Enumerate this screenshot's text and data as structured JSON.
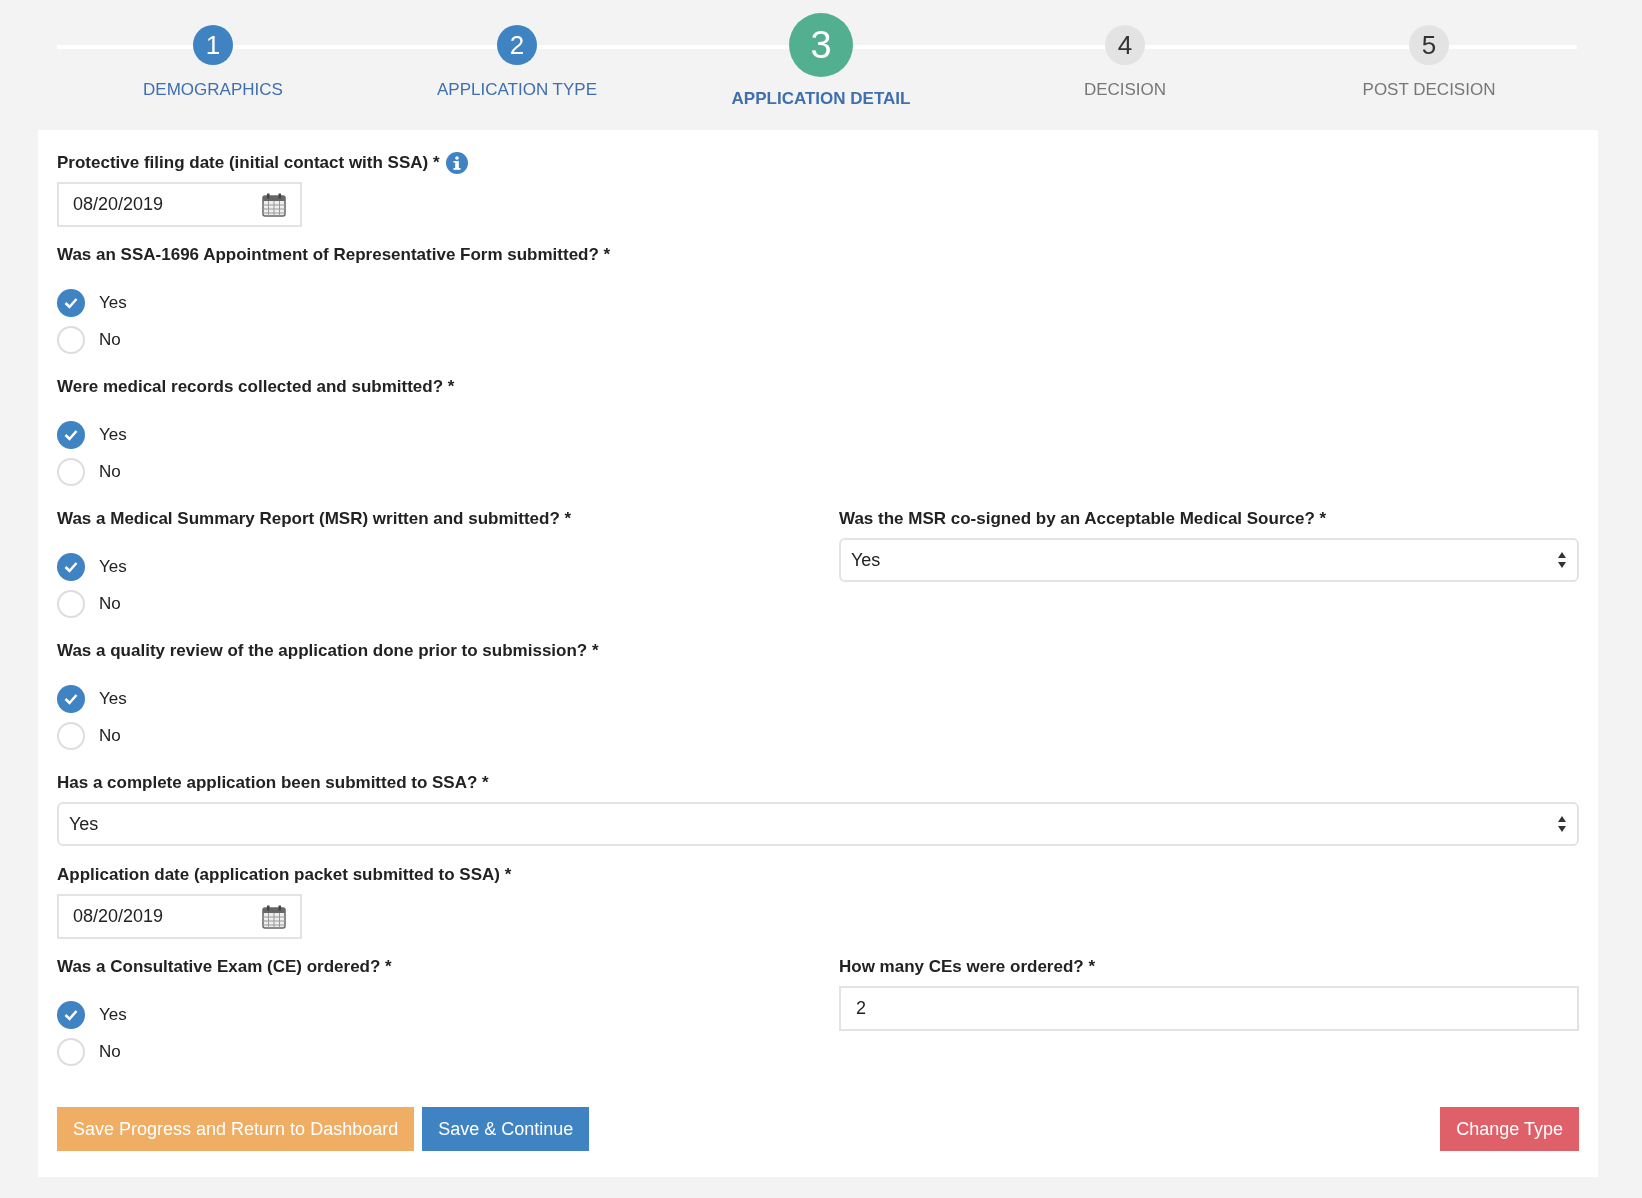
{
  "steps": [
    {
      "number": "1",
      "label": "DEMOGRAPHICS",
      "completed": true,
      "selected": false
    },
    {
      "number": "2",
      "label": "APPLICATION TYPE",
      "completed": true,
      "selected": false
    },
    {
      "number": "3",
      "label": "APPLICATION DETAIL",
      "completed": false,
      "selected": true
    },
    {
      "number": "4",
      "label": "DECISION",
      "completed": false,
      "selected": false
    },
    {
      "number": "5",
      "label": "POST DECISION",
      "completed": false,
      "selected": false
    }
  ],
  "rows": [
    {
      "fields": [
        {
          "kind": "date",
          "label": "Protective filing date (initial contact with SSA) *",
          "info": true,
          "value": "08/20/2019"
        }
      ]
    },
    {
      "fields": [
        {
          "kind": "radio",
          "label": "Was an SSA-1696 Appointment of Representative Form submitted? *",
          "options": [
            {
              "label": "Yes",
              "selected": true
            },
            {
              "label": "No",
              "selected": false
            }
          ]
        }
      ]
    },
    {
      "fields": [
        {
          "kind": "radio",
          "label": "Were medical records collected and submitted? *",
          "options": [
            {
              "label": "Yes",
              "selected": true
            },
            {
              "label": "No",
              "selected": false
            }
          ]
        }
      ]
    },
    {
      "fields": [
        {
          "kind": "radio",
          "label": "Was a Medical Summary Report (MSR) written and submitted? *",
          "options": [
            {
              "label": "Yes",
              "selected": true
            },
            {
              "label": "No",
              "selected": false
            }
          ]
        },
        {
          "kind": "select",
          "label": "Was the MSR co-signed by an Acceptable Medical Source? *",
          "value": "Yes"
        }
      ]
    },
    {
      "fields": [
        {
          "kind": "radio",
          "label": "Was a quality review of the application done prior to submission? *",
          "options": [
            {
              "label": "Yes",
              "selected": true
            },
            {
              "label": "No",
              "selected": false
            }
          ]
        }
      ]
    },
    {
      "fields": [
        {
          "kind": "select",
          "label": "Has a complete application been submitted to SSA? *",
          "value": "Yes"
        }
      ]
    },
    {
      "fields": [
        {
          "kind": "date",
          "label": "Application date (application packet submitted to SSA) *",
          "value": "08/20/2019"
        }
      ]
    },
    {
      "fields": [
        {
          "kind": "radio",
          "label": "Was a Consultative Exam (CE) ordered? *",
          "options": [
            {
              "label": "Yes",
              "selected": true
            },
            {
              "label": "No",
              "selected": false
            }
          ]
        },
        {
          "kind": "text",
          "label": "How many CEs were ordered? *",
          "value": "2"
        }
      ]
    }
  ],
  "buttons": [
    {
      "label": "Save Progress and Return to Dashboard",
      "kind": "warning"
    },
    {
      "label": "Save & Continue",
      "kind": "primary"
    },
    {
      "label": "Change Type",
      "kind": "danger"
    }
  ]
}
